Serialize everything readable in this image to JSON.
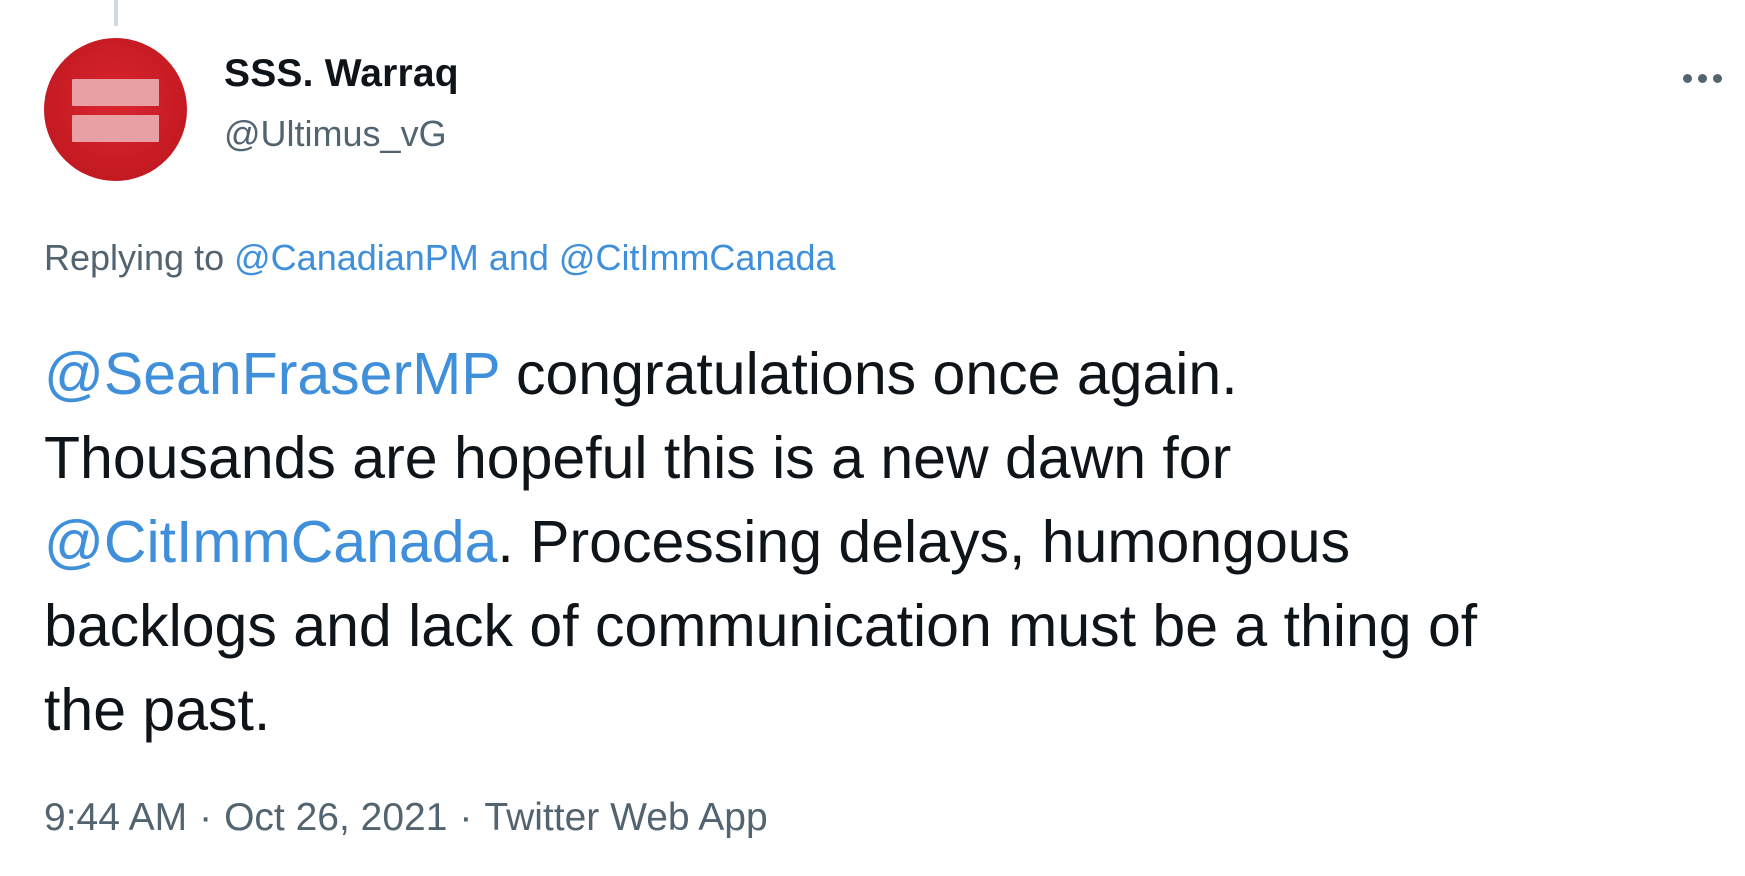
{
  "author": {
    "display_name": "SSS. Warraq",
    "handle": "@Ultimus_vG"
  },
  "replying": {
    "prefix": "Replying to",
    "mention_1": "@CanadianPM",
    "conjunction": "and",
    "mention_2": "@CitImmCanada"
  },
  "tweet": {
    "line1_mention": "@SeanFraserMP",
    "line1_text": " congratulations once again.",
    "line2_text": "Thousands are hopeful this is a new dawn for",
    "line3_mention": "@CitImmCanada",
    "line3_text": ". Processing delays, humongous",
    "line4_text": "backlogs and lack of communication must be a thing of",
    "line5_text": "the past."
  },
  "meta": {
    "time": "9:44 AM",
    "separator": "·",
    "date": "Oct 26, 2021",
    "source": "Twitter Web App"
  },
  "icons": {
    "avatar": "equality-sign-avatar",
    "more": "more-options-icon"
  },
  "colors": {
    "link": "#3f8fdb",
    "text": "#0f1419",
    "secondary": "#536471",
    "avatar_red": "#c41a22"
  }
}
